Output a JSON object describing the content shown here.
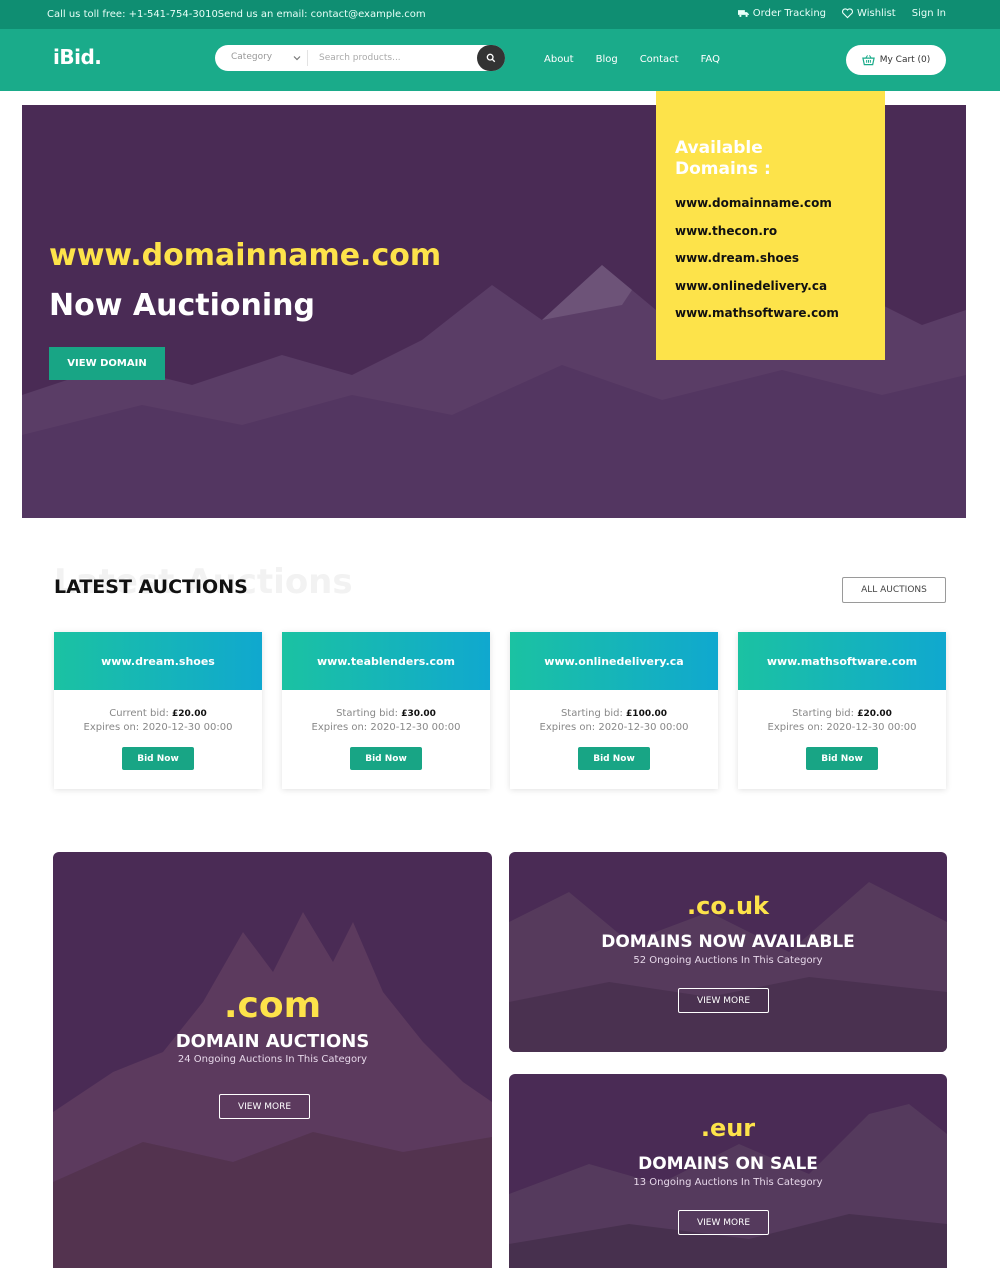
{
  "topbar": {
    "contact": "Call us toll free: +1-541-754-3010Send us an email: contact@example.com",
    "order_tracking": "Order Tracking",
    "wishlist": "Wishlist",
    "sign_in": "Sign In"
  },
  "header": {
    "logo": "iBid.",
    "category_label": "Category",
    "search_placeholder": "Search products...",
    "nav": [
      "About",
      "Blog",
      "Contact",
      "FAQ"
    ],
    "cart": "My Cart (0)"
  },
  "hero": {
    "domain": "www.domainname.com",
    "tagline": "Now Auctioning",
    "cta": "VIEW DOMAIN",
    "available_title": "Available Domains :",
    "available_domains": [
      "www.domainname.com",
      "www.thecon.ro",
      "www.dream.shoes",
      "www.onlinedelivery.ca",
      "www.mathsoftware.com"
    ]
  },
  "latest": {
    "title": "LATEST AUCTIONS",
    "ghost": "Latest Auctions",
    "all_button": "ALL AUCTIONS",
    "cards": [
      {
        "domain": "www.dream.shoes",
        "bid_label": "Current bid:",
        "bid": "£20.00",
        "expires": "Expires on: 2020-12-30 00:00",
        "button": "Bid Now"
      },
      {
        "domain": "www.teablenders.com",
        "bid_label": "Starting bid:",
        "bid": "£30.00",
        "expires": "Expires on: 2020-12-30 00:00",
        "button": "Bid Now"
      },
      {
        "domain": "www.onlinedelivery.ca",
        "bid_label": "Starting bid:",
        "bid": "£100.00",
        "expires": "Expires on: 2020-12-30 00:00",
        "button": "Bid Now"
      },
      {
        "domain": "www.mathsoftware.com",
        "bid_label": "Starting bid:",
        "bid": "£20.00",
        "expires": "Expires on: 2020-12-30 00:00",
        "button": "Bid Now"
      }
    ]
  },
  "categories": {
    "com": {
      "tld": ".com",
      "title": "DOMAIN AUCTIONS",
      "subtitle": "24 Ongoing Auctions In This Category",
      "button": "VIEW MORE"
    },
    "couk": {
      "tld": ".co.uk",
      "title": "DOMAINS NOW AVAILABLE",
      "subtitle": "52 Ongoing Auctions In This Category",
      "button": "VIEW MORE"
    },
    "eur": {
      "tld": ".eur",
      "title": "DOMAINS ON SALE",
      "subtitle": "13 Ongoing Auctions In This Category",
      "button": "VIEW MORE"
    }
  },
  "colors": {
    "topbar": "#0f8e72",
    "header": "#1aab8a",
    "accent_green": "#18a585",
    "hero_purple": "#4a2b55",
    "highlight_yellow": "#fde34a",
    "card_gradient": [
      "#1bc2a2",
      "#10a8cf"
    ]
  },
  "icons": [
    "truck-icon",
    "heart-icon",
    "chevron-down-icon",
    "search-icon",
    "basket-icon"
  ]
}
